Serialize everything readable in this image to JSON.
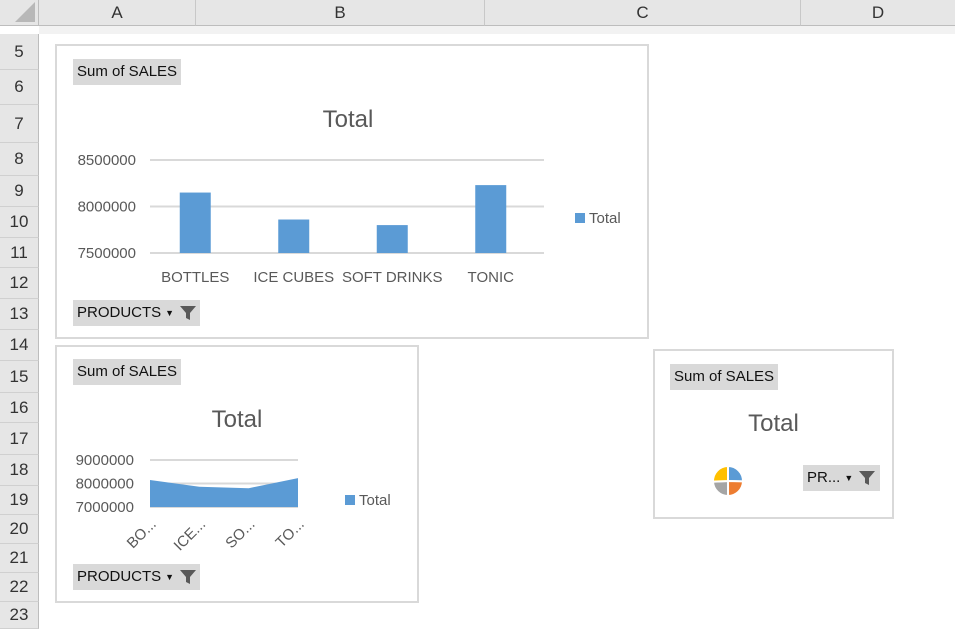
{
  "spreadsheet": {
    "columns": [
      "A",
      "B",
      "C",
      "D"
    ],
    "rows": [
      "5",
      "6",
      "7",
      "8",
      "9",
      "10",
      "11",
      "12",
      "13",
      "14",
      "15",
      "16",
      "17",
      "18",
      "19",
      "20",
      "21",
      "22",
      "23"
    ]
  },
  "colors": {
    "series": "#5b9bd5",
    "pie_orange": "#ed7d31",
    "pie_gray": "#a5a5a5",
    "pie_yellow": "#ffc000"
  },
  "charts": {
    "bar": {
      "field": "Sum of SALES",
      "title": "Total",
      "legend": "Total",
      "filter": "PRODUCTS"
    },
    "area": {
      "field": "Sum of SALES",
      "title": "Total",
      "legend": "Total",
      "filter": "PRODUCTS"
    },
    "pie": {
      "field": "Sum of SALES",
      "title": "Total",
      "filter": "PR..."
    }
  },
  "chart_data": [
    {
      "type": "bar",
      "title": "Total",
      "categories": [
        "BOTTLES",
        "ICE CUBES",
        "SOFT DRINKS",
        "TONIC"
      ],
      "series": [
        {
          "name": "Total",
          "values": [
            8150000,
            7860000,
            7800000,
            8230000
          ]
        }
      ],
      "yticks": [
        "7500000",
        "8000000",
        "8500000"
      ],
      "ylim": [
        7500000,
        8500000
      ],
      "grid": true,
      "legend_position": "right"
    },
    {
      "type": "area",
      "title": "Total",
      "categories": [
        "BO...",
        "ICE...",
        "SO...",
        "TO..."
      ],
      "series": [
        {
          "name": "Total",
          "values": [
            8150000,
            7860000,
            7800000,
            8230000
          ]
        }
      ],
      "yticks": [
        "7000000",
        "8000000",
        "9000000"
      ],
      "ylim": [
        7000000,
        9000000
      ],
      "grid": true,
      "legend_position": "right"
    },
    {
      "type": "pie",
      "title": "Total",
      "series": [
        {
          "name": "Total",
          "values": [
            8150000,
            7860000,
            7800000,
            8230000
          ]
        }
      ]
    }
  ]
}
